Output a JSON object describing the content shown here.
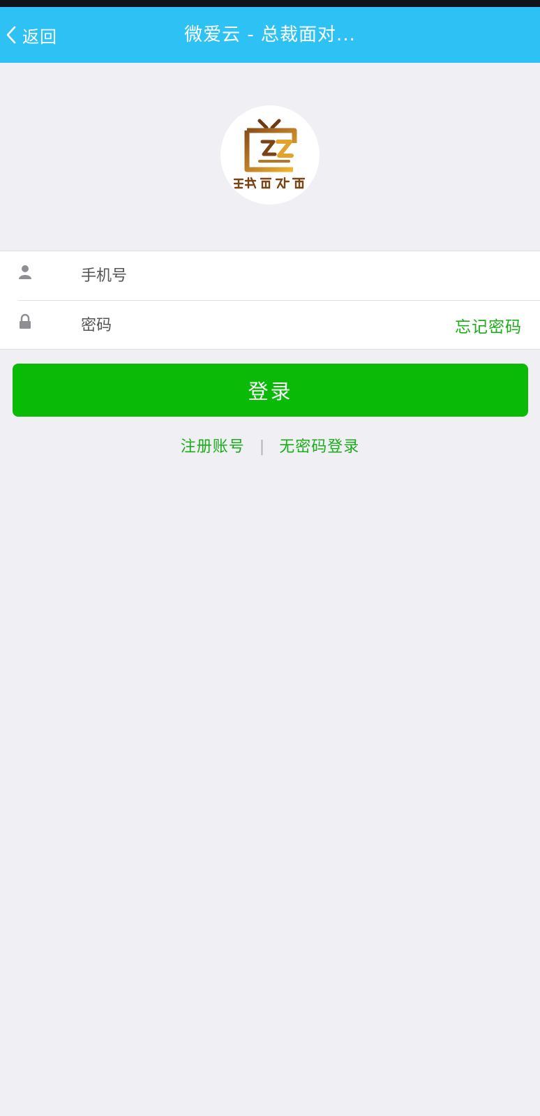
{
  "navbar": {
    "back_label": "返回",
    "title": "微爱云 - 总裁面对..."
  },
  "logo": {
    "text": "总裁面对面"
  },
  "form": {
    "phone_placeholder": "手机号",
    "password_placeholder": "密码",
    "forgot_label": "忘记密码"
  },
  "login_button": "登录",
  "links": {
    "register": "注册账号",
    "separator": "|",
    "passwordless": "无密码登录"
  },
  "icons": {
    "back": "chevron-left-icon",
    "user": "user-icon",
    "lock": "lock-icon"
  },
  "colors": {
    "navbar": "#2ec2f4",
    "primary_green": "#09bb07",
    "link_green": "#1aad19",
    "background": "#efeff4"
  }
}
